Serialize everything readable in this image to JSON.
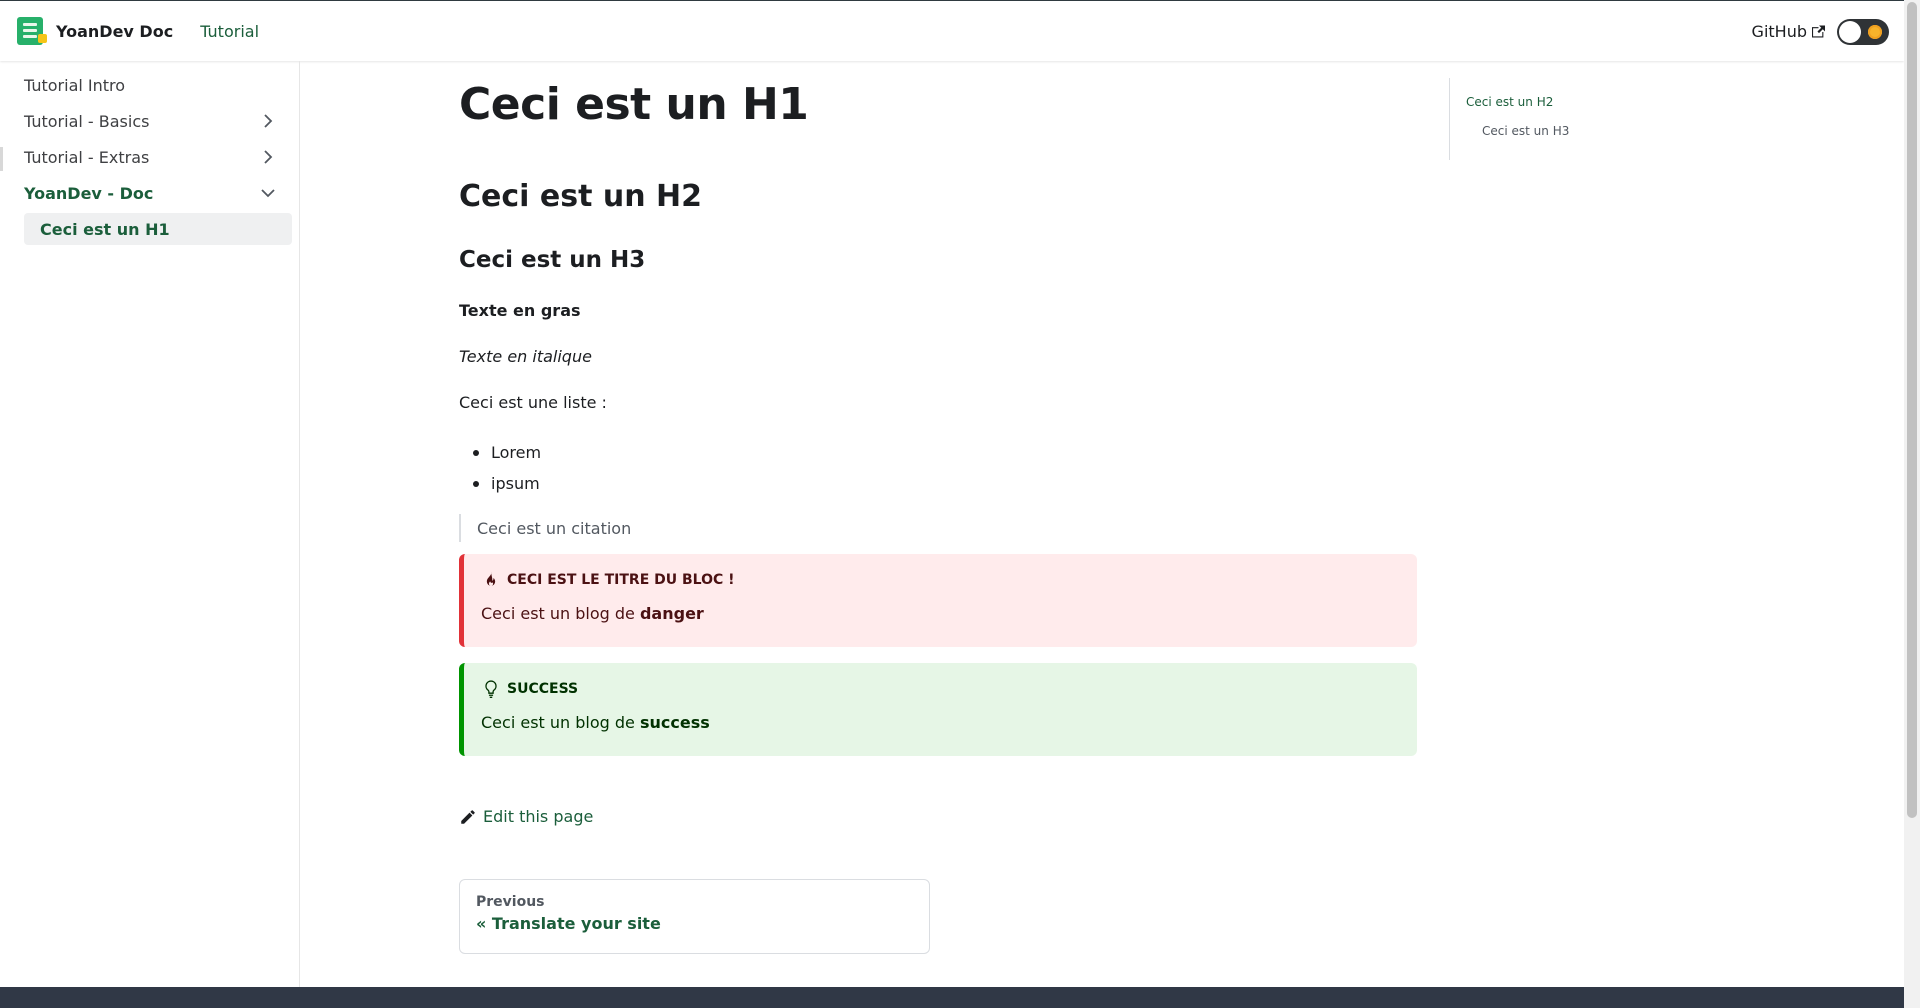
{
  "navbar": {
    "brand_title": "YoanDev Doc",
    "tutorial_link": "Tutorial",
    "github_link": "GitHub",
    "colors": {
      "accent": "#1b5e3b",
      "logo": "#27b06a"
    }
  },
  "sidebar": {
    "items": [
      {
        "label": "Tutorial Intro"
      },
      {
        "label": "Tutorial - Basics"
      },
      {
        "label": "Tutorial - Extras"
      },
      {
        "label": "YoanDev - Doc"
      }
    ],
    "sub_item": "Ceci est un H1"
  },
  "main": {
    "h1": "Ceci est un H1",
    "h2": "Ceci est un H2",
    "h3": "Ceci est un H3",
    "bold_text": "Texte en gras",
    "italic_text": "Texte en italique",
    "list_intro": "Ceci est une liste :",
    "list_items": [
      "Lorem",
      "ipsum"
    ],
    "quote": "Ceci est un citation",
    "danger": {
      "title": "CECI EST LE TITRE DU BLOC !",
      "text_prefix": "Ceci est un blog de ",
      "text_bold": "danger",
      "color": "#e13238"
    },
    "success": {
      "title": "SUCCESS",
      "text_prefix": "Ceci est un blog de ",
      "text_bold": "success",
      "color": "#009400"
    },
    "edit_link": "Edit this page",
    "pager": {
      "sub_label": "Previous",
      "label": "« Translate your site"
    }
  },
  "toc": {
    "items": [
      "Ceci est un H2",
      "Ceci est un H3"
    ]
  }
}
